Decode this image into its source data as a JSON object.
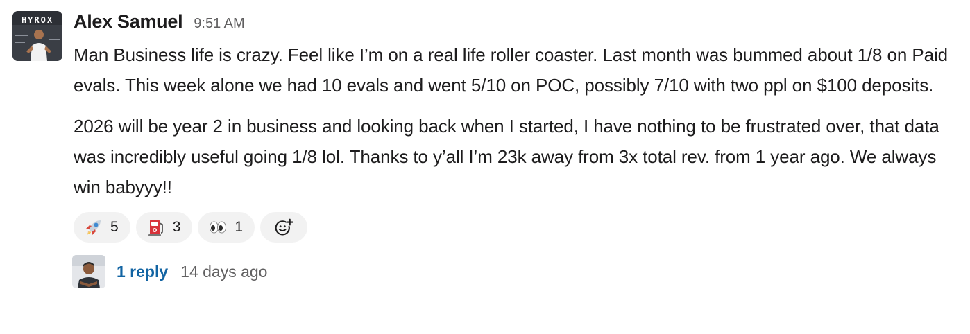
{
  "message": {
    "author": "Alex Samuel",
    "timestamp": "9:51 AM",
    "avatar_text": "HYROX",
    "paragraphs": [
      "Man Business life is crazy. Feel like I’m on a real life roller coaster. Last month was bummed about 1/8 on Paid evals. This week alone we had 10 evals and went 5/10 on POC, possibly 7/10 with two ppl on $100 deposits.",
      "2026 will be year 2 in business and looking back when I started, I have nothing to be frustrated over, that data was incredibly useful going 1/8 lol. Thanks to y’all I’m 23k away from 3x total rev. from 1 year ago.  We always win babyyy!!"
    ]
  },
  "reactions": [
    {
      "icon": "rocket-icon",
      "count": "5"
    },
    {
      "icon": "fuel-pump-icon",
      "count": "3"
    },
    {
      "icon": "eyes-icon",
      "count": "1"
    }
  ],
  "add_reaction": {
    "icon": "add-reaction-icon"
  },
  "thread": {
    "reply_label": "1 reply",
    "last_reply": "14 days ago"
  },
  "colors": {
    "link": "#1264a3",
    "muted": "#616061",
    "text": "#1d1c1d",
    "pill": "#f2f2f2"
  }
}
